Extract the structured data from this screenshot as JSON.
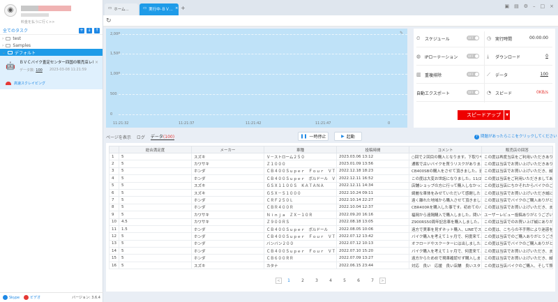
{
  "sidebar": {
    "upgrade_text": "料金を払うに行く>>",
    "all_tasks": "全てのタスク",
    "tree": [
      {
        "label": "test"
      },
      {
        "label": "Samples"
      },
      {
        "label": "デフォルト"
      }
    ],
    "task": {
      "title": "ＢＶＣバイク査定センター四国の販売店レビュー",
      "count_label": "データ数:",
      "count": "100",
      "timestamp": "2023-03-08 11:21:59",
      "status": "高速スクレイピング"
    },
    "footer": {
      "skype": "Skype",
      "video": "ビデオ",
      "version": "バージョン: 3.6.4"
    }
  },
  "tabs": [
    {
      "label": "ホーム..."
    },
    {
      "label": "実行中-ＢＶ..."
    }
  ],
  "chart_data": {
    "type": "area",
    "x": [
      "11:21:32",
      "11:21:37",
      "11:21:42",
      "11:21:47"
    ],
    "y_ticks": [
      "2,000",
      "1,500",
      "1,000",
      "500",
      "0"
    ],
    "end_label": "0"
  },
  "stats": {
    "schedule": "スケジュール",
    "schedule_toggle": "OFF",
    "ip_rotation": "IPローテーション",
    "ip_toggle": "OFF",
    "dedupe": "重複排除",
    "dedupe_toggle": "OFF",
    "autoexport": "自動エクスポート",
    "autoexport_toggle": "OFF",
    "runtime_label": "実行時間",
    "runtime": "00:00:00",
    "download_label": "ダウンロード",
    "download": "0",
    "data_label": "データ",
    "data": "100",
    "speed_label": "スピード",
    "speed": "0KB/s",
    "speedup": "スピードアップ"
  },
  "subtabs": {
    "page_view": "ページを表示",
    "log": "ログ",
    "data": "データ",
    "data_count": "(100)"
  },
  "controls": {
    "pause": "一時停止",
    "start": "起動",
    "help": "問題があったらここをクリックしてください"
  },
  "table": {
    "headers": [
      "",
      "総合満足度",
      "メーカー",
      "車種",
      "投稿時間",
      "コメント",
      "販売店の回答"
    ],
    "rows": [
      [
        "1",
        "5",
        "スズキ",
        "Ｖ－ストローム２５０",
        "2023.03.06 13:12",
        "○回で２回目の購入となります。下取りや...",
        "この度は再度当店をご利用いただきありが..."
      ],
      [
        "2",
        "5",
        "カワサキ",
        "Ｚ１０００",
        "2023.01.09 13:56",
        "通販で古いバイクを買うリスクがありま...",
        "この度は当店でお買い上げいただきありが..."
      ],
      [
        "3",
        "5",
        "ホンダ",
        "ＣＢ４００Ｓｕｐｅｒ　Ｆｏｕｒ　ＶＴＥＣ",
        "2022.12.18 18:23",
        "CB400SBの購入をさせて頂きました。速方...",
        "この度は当店でお買い上げいただき、誠..."
      ],
      [
        "4",
        "5",
        "ホンダ",
        "ＣＢ４００Ｓｕｐｅｒ　ボルドール　ＶＴ...",
        "2022.12.11 16:52",
        "この度は大変お世話になりました。11/25...",
        "この度は当店をご利用いただきましてあり..."
      ],
      [
        "5",
        "5",
        "スズキ",
        "ＧＳＸ１１００Ｓ　ＫＡＴＡＮＡ",
        "2022.12.11 14:34",
        "店舗ショップの方に行って購入しなかった...",
        "この度は当店にちかそれからバイクのご購..."
      ],
      [
        "6",
        "5",
        "スズキ",
        "ＧＳＸ－Ｓ１０００",
        "2022.10.24 09:11",
        "綺麗な車体をみせていただいて感謝したく...",
        "この度は当店でお買い上げいただき誠にあ..."
      ],
      [
        "7",
        "5",
        "ホンダ",
        "ＣＲＦ２５０Ｌ",
        "2022.10.14 22:27",
        "遠く離れた地域から購入させて頂きました...",
        "この度は当店でバイクのご購入ありがとう..."
      ],
      [
        "8",
        "5",
        "ホンダ",
        "ＣＢＲ４００Ｒ",
        "2022.10.04 12:37",
        "CBR400Rを購入した事です。初めてのバイ...",
        "この度は当店でお買い上げいただき、またレビュー..."
      ],
      [
        "9",
        "5",
        "カワサキ",
        "Ｎｉｎｊａ　ＺＸ－１０Ｒ",
        "2022.09.20 16:16",
        "福岡から遠隔購入で購入しました。問い合...",
        "ユーザーレビュー投稿ありがとうござい..."
      ],
      [
        "10",
        "4.5",
        "カワサキ",
        "Ｚ９００ＲＳ",
        "2022.08.18 13:05",
        "Z900RS50周年記念車を購入しました。現...",
        "この度は当店でのお買い上げ誠にありがと..."
      ],
      [
        "11",
        "1.5",
        "ホンダ",
        "ＣＢ４００Ｓｕｐｅｒ　ボルドール",
        "2022.08.05 10:06",
        "遠方で実車を見ずネット購入、LINEでスタ...",
        "この度は、こちらの不手際により迷惑を..."
      ],
      [
        "12",
        "5",
        "ホンダ",
        "ＣＢ４００Ｓｕｐｅｒ　Ｆｏｕｒ　ＶＴＥＣ",
        "2022.07.12 13:42",
        "バイク購入を考えて１ヶ月で、何度来て...",
        "この度は当店でのご購入ありがとうございます..."
      ],
      [
        "13",
        "5",
        "ホンダ",
        "バンバン２００",
        "2022.07.12 10:13",
        "オフロードやスクーターには出しました...",
        "この度は当店でバイクのご購入ありがと..."
      ],
      [
        "14",
        "5",
        "ホンダ",
        "ＣＢ４００Ｓｕｐｅｒ　Ｆｏｕｒ　ＶＴＥＣ",
        "2022.07.10 15:20",
        "バイク購入を考えて１ヶ月で、何度来て...",
        "この度は当店でお買い上げいただき、また福岡県..."
      ],
      [
        "15",
        "5",
        "ホンダ",
        "ＣＢ６００ＲＲ",
        "2022.07.09 13:27",
        "遠方からためめで現車確認せず購入しまし...",
        "この度は当店でお買い上げいただき、誠に..."
      ],
      [
        "16",
        "5",
        "スズキ",
        "カタナ",
        "2022.06.15 23:44",
        "対応　良い　応援　良い店舗　良いスタッフ...",
        "この度は当店バイクのご購入、そして照レビュー..."
      ]
    ]
  },
  "pager": {
    "pages": [
      "1",
      "2",
      "3",
      "4",
      "5",
      "6",
      "7"
    ],
    "prev": "<",
    "next": ">"
  }
}
